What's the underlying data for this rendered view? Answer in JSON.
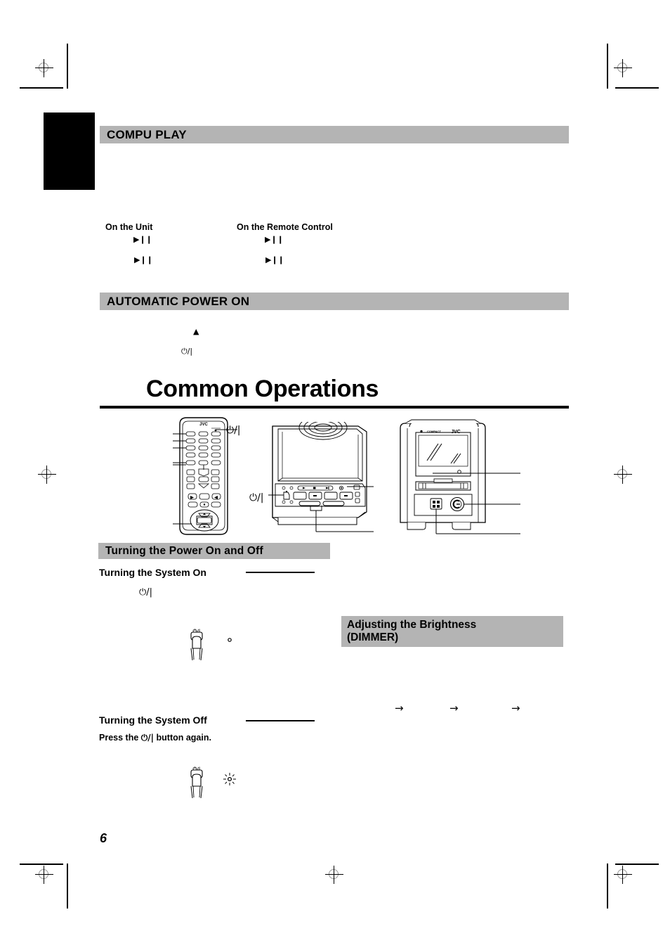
{
  "page": {
    "folio": "6",
    "paper_bg": "#ffffff",
    "bar_color": "#b4b4b4",
    "ink_color": "#000000"
  },
  "sections": {
    "compu_play": {
      "bar_label": "COMPU PLAY",
      "col_headers": {
        "unit": "On the Unit",
        "remote": "On the Remote Control"
      },
      "glyphs": {
        "play_pause": "▶❙❙"
      }
    },
    "automatic_power_on": {
      "bar_label": "AUTOMATIC POWER ON",
      "glyphs": {
        "eject": "▲",
        "power": "⏻/|"
      }
    },
    "chapter": {
      "title": "Common Operations"
    },
    "turning_power": {
      "bar_label": "Turning the Power On and Off",
      "system_on": {
        "heading": "Turning the System On",
        "power_glyph": "⏻/|"
      },
      "system_off": {
        "heading": "Turning the System Off",
        "instruction_pre": "Press the ",
        "instruction_glyph": "⏻/|",
        "instruction_post": " button again."
      }
    },
    "dimmer": {
      "bar_label_line1": "Adjusting the Brightness",
      "bar_label_line2": "(DIMMER)",
      "arrows": [
        "→",
        "→",
        "→"
      ]
    }
  },
  "illustrations": {
    "remote": {
      "name": "jvc-remote-control",
      "brand": "JVC",
      "callout_power": "⏻/|"
    },
    "main_unit": {
      "name": "main-stereo-unit-front-panel",
      "callout_power": "⏻/|"
    },
    "tower_unit": {
      "name": "tower-component-unit-front-panel",
      "brand": "JVC"
    }
  },
  "press_icons": {
    "system_on": {
      "name": "finger-pressing-power-button-icon",
      "indicator": "dot"
    },
    "system_off": {
      "name": "finger-pressing-power-button-icon",
      "indicator": "light-rays"
    }
  }
}
